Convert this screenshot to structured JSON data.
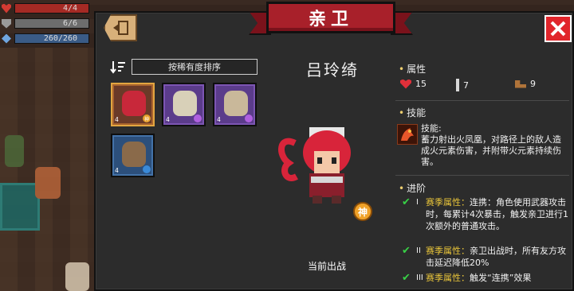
{
  "hud": {
    "hp": "4/4",
    "armor": "6/6",
    "energy": "260/260"
  },
  "panel": {
    "title": "亲卫",
    "sort_label": "按稀有度排序",
    "character": {
      "name": "吕玲绮",
      "status": "当前出战",
      "divine_label": "神"
    },
    "roster": [
      {
        "level": "4",
        "badge": "神",
        "tier": "legendary"
      },
      {
        "level": "4",
        "badge": "",
        "tier": "epic"
      },
      {
        "level": "4",
        "badge": "",
        "tier": "epic"
      },
      {
        "level": "4",
        "badge": "",
        "tier": "rare"
      }
    ],
    "attributes": {
      "title": "属性",
      "hp": "15",
      "attack": "7",
      "speed": "9"
    },
    "skill": {
      "title": "技能",
      "label": "技能:",
      "description": "蓄力射出火凤凰，对路径上的敌人造成火元素伤害，并附带火元素持续伤害。"
    },
    "advancement": {
      "title": "进阶",
      "items": [
        {
          "numeral": "I",
          "prefix": "赛季属性：",
          "text": "连携：角色使用武器攻击时，每累计4次暴击，触发亲卫进行1次额外的普通攻击。"
        },
        {
          "numeral": "II",
          "prefix": "赛季属性：",
          "text": "亲卫出战时，所有友方攻击延迟降低20%"
        },
        {
          "numeral": "III",
          "prefix": "赛季属性：",
          "text": "触发“连携”效果"
        }
      ]
    }
  },
  "colors": {
    "panel_bg": "#2c2c2c",
    "banner": "#a8202a",
    "close": "#e1252b",
    "highlight": "#e8c43a",
    "check": "#38d046"
  }
}
